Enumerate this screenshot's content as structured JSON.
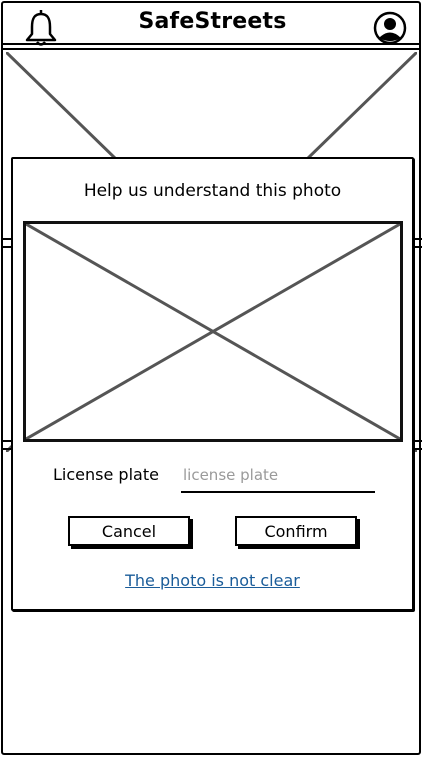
{
  "app": {
    "title": "SafeStreets"
  },
  "header": {
    "left_icon": "bell-icon",
    "right_icon": "user-avatar-icon"
  },
  "dialog": {
    "title": "Help us understand this photo",
    "photo_placeholder": "image-placeholder",
    "license_plate_label": "License plate",
    "license_plate_placeholder": "license plate",
    "license_plate_value": "",
    "cancel_label": "Cancel",
    "confirm_label": "Confirm",
    "unclear_link": "The photo is not clear"
  }
}
